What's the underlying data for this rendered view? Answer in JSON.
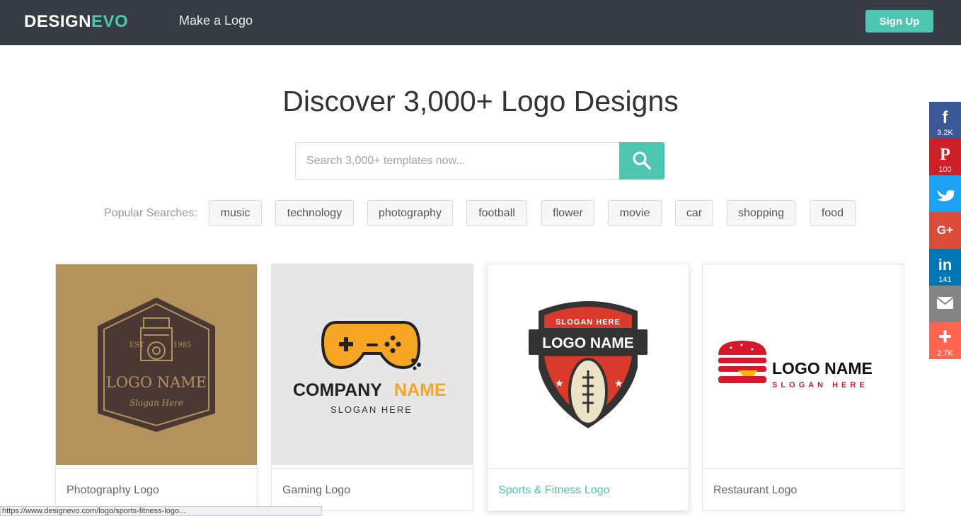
{
  "header": {
    "logo_part1": "DESIGN",
    "logo_part2": "EVO",
    "nav_make_logo": "Make a Logo",
    "signup_label": "Sign Up"
  },
  "hero": {
    "title": "Discover 3,000+ Logo Designs",
    "search_placeholder": "Search 3,000+ templates now...",
    "search_value": ""
  },
  "popular": {
    "label": "Popular Searches:",
    "chips": [
      "music",
      "technology",
      "photography",
      "football",
      "flower",
      "movie",
      "car",
      "shopping",
      "food"
    ]
  },
  "cards": [
    {
      "caption": "Photography Logo",
      "logo_name": "LOGO NAME",
      "slogan": "Slogan Here",
      "est": "EST",
      "year": "1985"
    },
    {
      "caption": "Gaming Logo",
      "company": "COMPANY",
      "name": "NAME",
      "slogan": "SLOGAN HERE"
    },
    {
      "caption": "Sports & Fitness Logo",
      "slogan": "SLOGAN HERE",
      "logo_name": "LOGO NAME"
    },
    {
      "caption": "Restaurant Logo",
      "logo_name": "LOGO NAME",
      "slogan": "SLOGAN HERE"
    }
  ],
  "social": [
    {
      "icon": "facebook-icon",
      "count": "3.2K",
      "color": "#3b5998"
    },
    {
      "icon": "pinterest-icon",
      "count": "100",
      "color": "#cb2027"
    },
    {
      "icon": "twitter-icon",
      "count": "",
      "color": "#1da1f2"
    },
    {
      "icon": "google-plus-icon",
      "count": "",
      "color": "#dd4b39"
    },
    {
      "icon": "linkedin-icon",
      "count": "141",
      "color": "#0077b5"
    },
    {
      "icon": "email-icon",
      "count": "",
      "color": "#848484"
    },
    {
      "icon": "share-plus-icon",
      "count": "2.7K",
      "color": "#ff6550"
    }
  ],
  "colors": {
    "accent": "#4ec5b0",
    "header_bg": "#373b44"
  },
  "status_url": "https://www.designevo.com/logo/sports-fitness-logo..."
}
